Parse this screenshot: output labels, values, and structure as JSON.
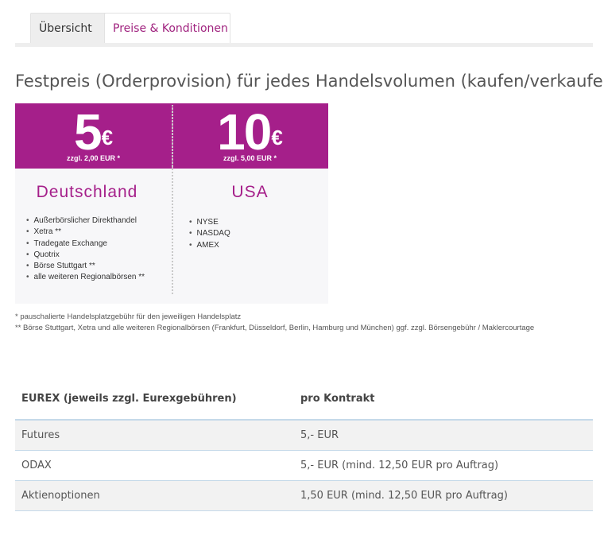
{
  "tabs": [
    {
      "label": "Übersicht",
      "active": true
    },
    {
      "label": "Preise & Konditionen",
      "active": false
    }
  ],
  "heading": "Festpreis (Orderprovision) für jedes Handelsvolumen (kaufen/verkaufen)",
  "banner": {
    "accent_color": "#a51f8a",
    "germany": {
      "price": "5",
      "currency": "€",
      "note": "zzgl. 2,00 EUR *",
      "country": "Deutschland",
      "venues": [
        "Außerbörslicher Direkthandel",
        "Xetra **",
        "Tradegate Exchange",
        "Quotrix",
        "Börse Stuttgart **",
        "alle weiteren Regionalbörsen **"
      ]
    },
    "usa": {
      "price": "10",
      "currency": "€",
      "note": "zzgl. 5,00 EUR *",
      "country": "USA",
      "venues": [
        "NYSE",
        "NASDAQ",
        "AMEX"
      ]
    }
  },
  "footnotes": [
    "* pauschalierte Handelsplatzgebühr für den jeweiligen Handelsplatz",
    "** Börse Stuttgart, Xetra und alle weiteren Regionalbörsen (Frankfurt, Düsseldorf, Berlin, Hamburg und München) ggf. zzgl. Börsengebühr / Maklercourtage"
  ],
  "eurex_table": {
    "headers": [
      "EUREX (jeweils zzgl. Eurexgebühren)",
      "pro Kontrakt"
    ],
    "rows": [
      [
        "Futures",
        "5,- EUR"
      ],
      [
        "ODAX",
        "5,- EUR (mind. 12,50 EUR pro Auftrag)"
      ],
      [
        "Aktienoptionen",
        "1,50 EUR (mind. 12,50 EUR pro Auftrag)"
      ]
    ]
  }
}
